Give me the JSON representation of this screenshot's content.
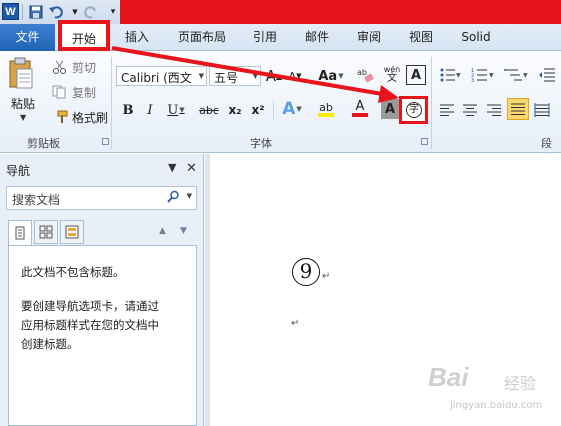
{
  "qat": {
    "logo": "W",
    "save_icon": "save-icon",
    "undo_icon": "undo-icon",
    "redo_icon": "redo-icon"
  },
  "tabs": {
    "file": "文件",
    "home": "开始",
    "insert": "插入",
    "page_layout": "页面布局",
    "references": "引用",
    "mailings": "邮件",
    "review": "审阅",
    "view": "视图",
    "solid": "Solid"
  },
  "clipboard": {
    "paste": "粘贴",
    "cut": "剪切",
    "copy": "复制",
    "format_painter": "格式刷",
    "group_label": "剪贴板"
  },
  "font": {
    "font_name": "Calibri (西文",
    "font_size": "五号",
    "bold": "B",
    "italic": "I",
    "underline": "U",
    "strike": "abc",
    "subscript": "x₂",
    "superscript": "x²",
    "clear_format_label": "Aa",
    "phonetic": "wén",
    "char_border": "A",
    "text_effect": "A",
    "highlight": "ab",
    "font_color": "A",
    "char_shading": "A",
    "enclose_char": "字",
    "grow": "A",
    "shrink": "A",
    "group_label": "字体"
  },
  "paragraph": {
    "group_label": "段落"
  },
  "nav": {
    "title": "导航",
    "search_placeholder": "搜索文档",
    "empty_title": "此文档不包含标题。",
    "hint_line1": "要创建导航选项卡，请通过",
    "hint_line2": "应用标题样式在您的文档中",
    "hint_line3": "创建标题。"
  },
  "document": {
    "enclosed_char": "9",
    "para_mark": "↵"
  },
  "watermark": {
    "logo": "Bai",
    "text": "经验",
    "url": "jingyan.baidu.com"
  },
  "colors": {
    "annotation_red": "#e8141b",
    "file_tab_blue": "#2263b5",
    "highlight_yellow": "#fbd872"
  }
}
